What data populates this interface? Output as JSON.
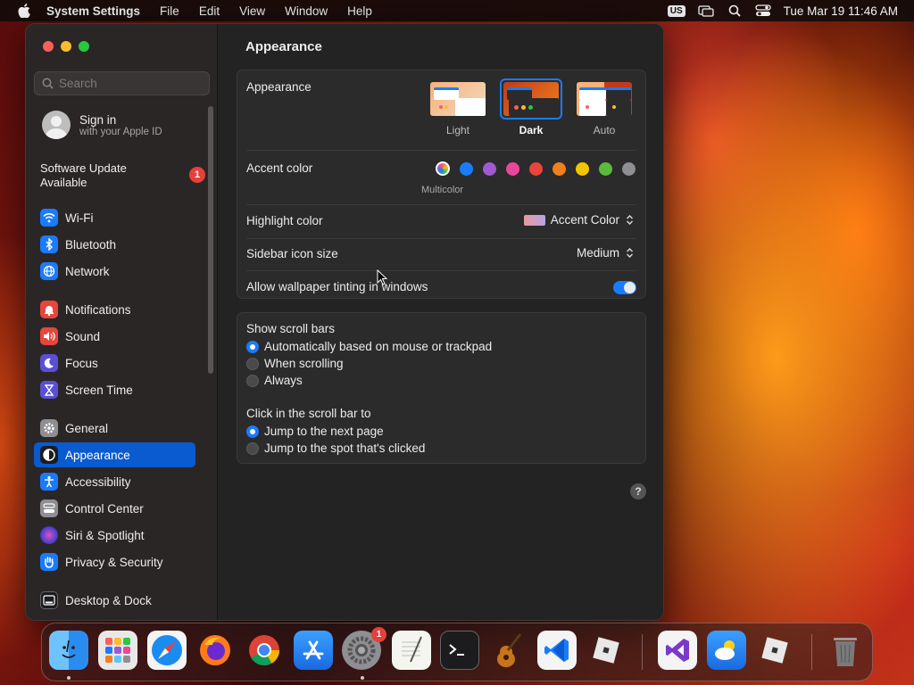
{
  "menubar": {
    "app_name": "System Settings",
    "menus": [
      "File",
      "Edit",
      "View",
      "Window",
      "Help"
    ],
    "input_source": "US",
    "clock": "Tue Mar 19  11:46 AM"
  },
  "sidebar": {
    "search_placeholder": "Search",
    "signin_title": "Sign in",
    "signin_subtitle": "with your Apple ID",
    "update_text": "Software Update Available",
    "update_badge": "1",
    "items": [
      {
        "label": "Wi-Fi",
        "icon": "wifi-icon",
        "color": "#1a7bff"
      },
      {
        "label": "Bluetooth",
        "icon": "bluetooth-icon",
        "color": "#1a7bff"
      },
      {
        "label": "Network",
        "icon": "globe-icon",
        "color": "#1a7bff"
      },
      {
        "label": "Notifications",
        "icon": "bell-icon",
        "color": "#e8453c"
      },
      {
        "label": "Sound",
        "icon": "speaker-icon",
        "color": "#e8453c"
      },
      {
        "label": "Focus",
        "icon": "moon-icon",
        "color": "#5a4fd6"
      },
      {
        "label": "Screen Time",
        "icon": "hourglass-icon",
        "color": "#5a4fd6"
      },
      {
        "label": "General",
        "icon": "gear-icon",
        "color": "#8e8e93"
      },
      {
        "label": "Appearance",
        "icon": "appearance-icon",
        "color": "#1c1c1e"
      },
      {
        "label": "Accessibility",
        "icon": "accessibility-icon",
        "color": "#1a7bff"
      },
      {
        "label": "Control Center",
        "icon": "control-center-icon",
        "color": "#8e8e93"
      },
      {
        "label": "Siri & Spotlight",
        "icon": "siri-icon",
        "color": "#3a2a6a"
      },
      {
        "label": "Privacy & Security",
        "icon": "hand-icon",
        "color": "#1a7bff"
      },
      {
        "label": "Desktop & Dock",
        "icon": "dock-icon",
        "color": "#1c1c1e"
      }
    ],
    "selected": "Appearance"
  },
  "main": {
    "title": "Appearance",
    "appearance": {
      "label": "Appearance",
      "options": [
        "Light",
        "Dark",
        "Auto"
      ],
      "selected": "Dark"
    },
    "accent": {
      "label": "Accent color",
      "multicolor_label": "Multicolor",
      "colors": [
        "#1a7bff",
        "#a05ad0",
        "#e8479a",
        "#e8453c",
        "#f0801e",
        "#f5c400",
        "#5cb93d",
        "#8e8e93"
      ]
    },
    "highlight": {
      "label": "Highlight color",
      "value": "Accent Color"
    },
    "sidebar_icon_size": {
      "label": "Sidebar icon size",
      "value": "Medium"
    },
    "wallpaper_tinting": {
      "label": "Allow wallpaper tinting in windows",
      "enabled": true
    },
    "scroll_bars": {
      "label": "Show scroll bars",
      "options": [
        "Automatically based on mouse or trackpad",
        "When scrolling",
        "Always"
      ],
      "selected": 0
    },
    "click_scroll": {
      "label": "Click in the scroll bar to",
      "options": [
        "Jump to the next page",
        "Jump to the spot that's clicked"
      ],
      "selected": 0
    },
    "help": "?"
  },
  "dock": {
    "settings_badge": "1"
  }
}
